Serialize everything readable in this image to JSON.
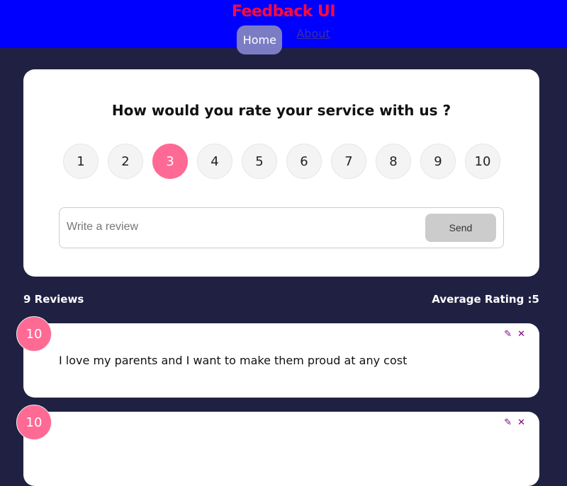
{
  "header": {
    "title": "Feedback UI",
    "nav": [
      {
        "label": "Home"
      },
      {
        "label": "About"
      }
    ]
  },
  "form": {
    "question": "How would you rate your service with us ?",
    "ratings": [
      "1",
      "2",
      "3",
      "4",
      "5",
      "6",
      "7",
      "8",
      "9",
      "10"
    ],
    "selected": "3",
    "placeholder": "Write a review",
    "send_label": "Send"
  },
  "stats": {
    "count": "9 Reviews",
    "average": "Average Rating :5"
  },
  "reviews": [
    {
      "rating": "10",
      "text": "I love my parents and I want to make them proud at any cost"
    },
    {
      "rating": "10",
      "text": ""
    }
  ],
  "colors": {
    "header": "#0000ff",
    "title": "#ff0a3c",
    "accent": "#ff6a95",
    "background": "#202142",
    "icons": "#800080"
  }
}
